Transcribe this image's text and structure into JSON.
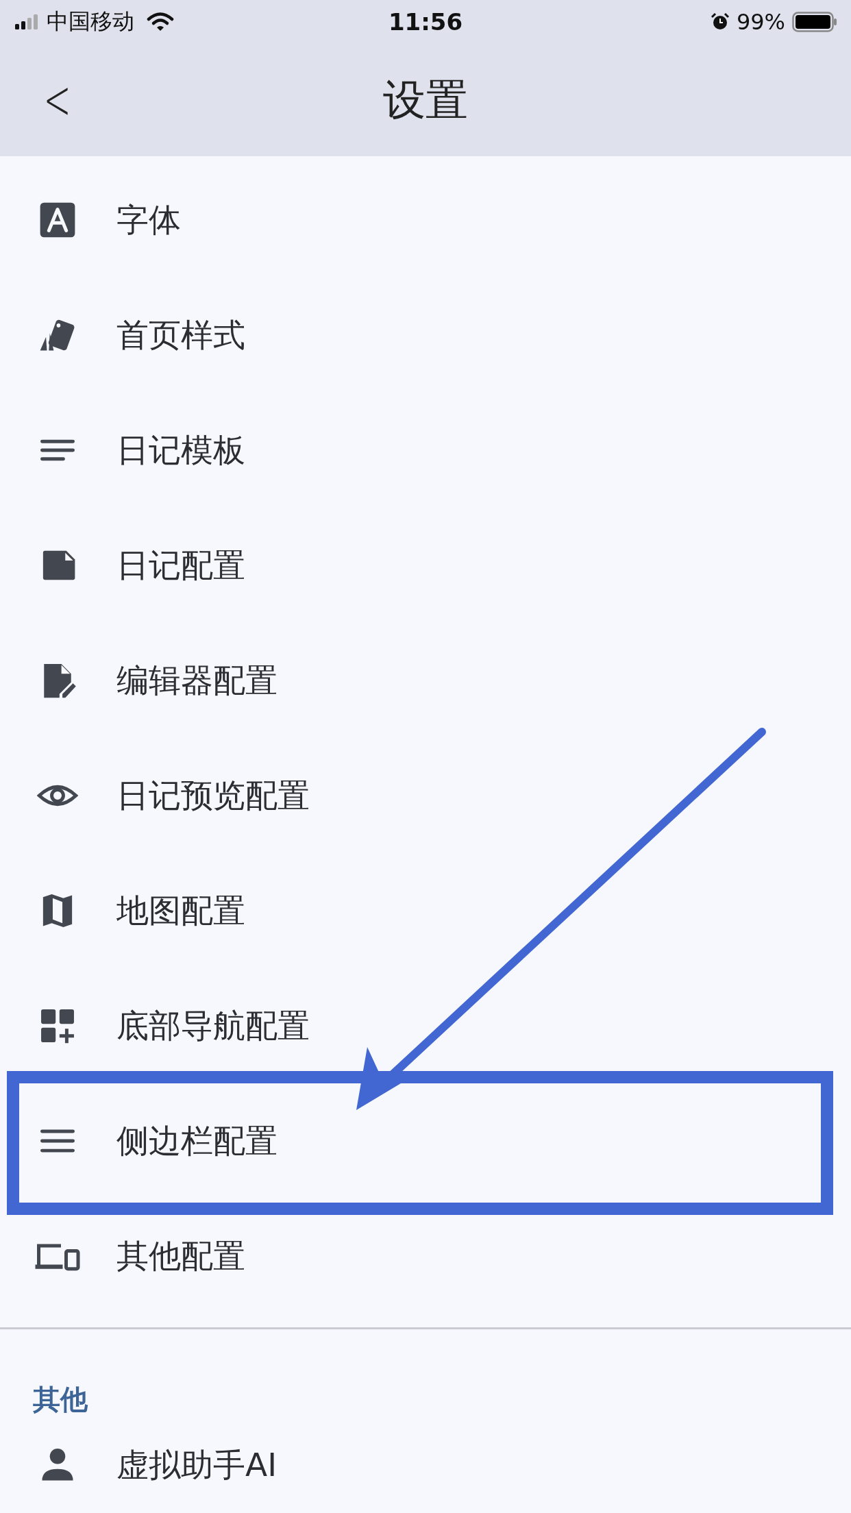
{
  "status_bar": {
    "carrier": "中国移动",
    "time": "11:56",
    "battery": "99%"
  },
  "nav_bar": {
    "back": "<",
    "title": "设置"
  },
  "items": [
    {
      "kind": "font",
      "label": "字体"
    },
    {
      "kind": "cards",
      "label": "首页样式"
    },
    {
      "kind": "notes",
      "label": "日记模板"
    },
    {
      "kind": "file",
      "label": "日记配置"
    },
    {
      "kind": "edit",
      "label": "编辑器配置"
    },
    {
      "kind": "eye",
      "label": "日记预览配置"
    },
    {
      "kind": "map",
      "label": "地图配置"
    },
    {
      "kind": "grid",
      "label": "底部导航配置"
    },
    {
      "kind": "menu",
      "label": "侧边栏配置"
    },
    {
      "kind": "devices",
      "label": "其他配置"
    }
  ],
  "section": {
    "header": "其他",
    "items": [
      {
        "kind": "person",
        "label": "虚拟助手AI"
      }
    ]
  }
}
